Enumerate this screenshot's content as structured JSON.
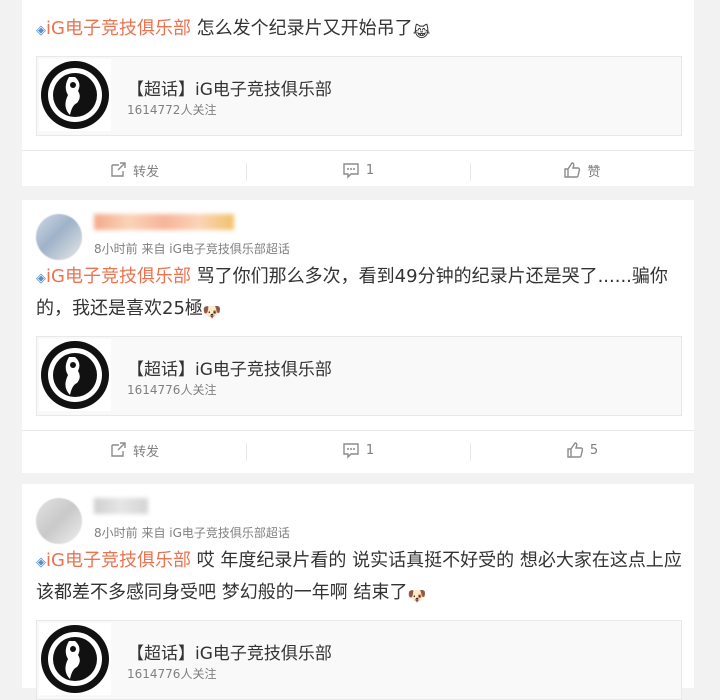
{
  "posts": [
    {
      "username": "",
      "meta_time": "",
      "meta_from": "",
      "text_topic": "iG电子竞技俱乐部",
      "text_body": " 怎么发个纪录片又开始吊了",
      "emoji": "cry-laugh-emoji",
      "share_title": "【超话】iG电子竞技俱乐部",
      "share_followers": "1614772人关注",
      "repost_label": "转发",
      "comment_count": "1",
      "like_label": "赞"
    },
    {
      "username": "",
      "meta_time": "8小时前",
      "meta_from": "来自 iG电子竞技俱乐部超话",
      "text_topic": "iG电子竞技俱乐部",
      "text_body": " 骂了你们那么多次，看到49分钟的纪录片还是哭了......骗你的，我还是喜欢25極",
      "emoji": "doge-emoji",
      "share_title": "【超话】iG电子竞技俱乐部",
      "share_followers": "1614776人关注",
      "repost_label": "转发",
      "comment_count": "1",
      "like_label": "5"
    },
    {
      "username": "",
      "meta_time": "8小时前",
      "meta_from": "来自 iG电子竞技俱乐部超话",
      "text_topic": "iG电子竞技俱乐部",
      "text_body": " 哎 年度纪录片看的 说实话真挺不好受的 想必大家在这点上应该都差不多感同身受吧 梦幻般的一年啊 结束了",
      "emoji": "doge-emoji",
      "share_title": "【超话】iG电子竞技俱乐部",
      "share_followers": "1614776人关注"
    }
  ]
}
